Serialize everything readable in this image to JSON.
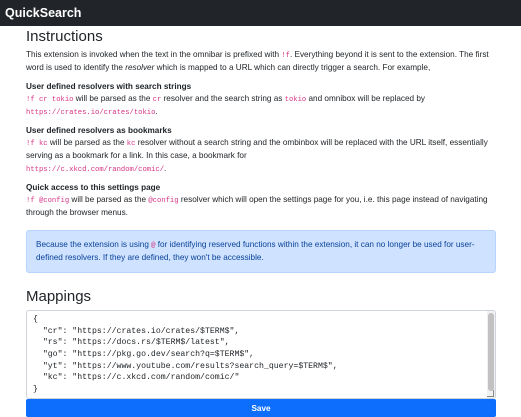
{
  "navbar": {
    "brand": "QuickSearch"
  },
  "instructions": {
    "title": "Instructions",
    "intro": {
      "t1": "This extension is invoked when the text in the omnibar is prefixed with ",
      "c1": "!f",
      "t2": ". Everything beyond it is sent to the extension. The first word is used to identify the ",
      "em": "resolver",
      "t3": " which is mapped to a URL which can directly trigger a search. For example,"
    },
    "search_strings": {
      "heading": "User defined resolvers with search strings",
      "c1": "!f cr tokio",
      "t1": " will be parsed as the ",
      "c2": "cr",
      "t2": " resolver and the search string as ",
      "c3": "tokio",
      "t3": " and omnibox will be replaced by ",
      "c4": "https://crates.io/crates/tokio",
      "t4": "."
    },
    "bookmarks": {
      "heading": "User defined resolvers as bookmarks",
      "c1": "!f kc",
      "t1": " will be parsed as the ",
      "c2": "kc",
      "t2": " resolver without a search string and the ombinbox will be replaced with the URL itself, essentially serving as a bookmark for a link. In this case, a bookmark for ",
      "c3": "https://c.xkcd.com/random/comic/",
      "t3": "."
    },
    "settings": {
      "heading": "Quick access to this settings page",
      "c1": "!f @config",
      "t1": " will be parsed as the ",
      "c2": "@config",
      "t2": " resolver which will open the settings page for you, i.e. this page instead of navigating through the browser menus."
    },
    "alert": {
      "t1": "Because the extension is using ",
      "c1": "@",
      "t2": " for identifying reserved functions within the extension, it can no longer be used for user-defined resolvers. If they are defined, they won't be accessible."
    }
  },
  "mappings": {
    "title": "Mappings",
    "json_text": "{\n  \"cr\": \"https://crates.io/crates/$TERM$\",\n  \"rs\": \"https://docs.rs/$TERM$/latest\",\n  \"go\": \"https://pkg.go.dev/search?q=$TERM$\",\n  \"yt\": \"https://www.youtube.com/results?search_query=$TERM$\",\n  \"kc\": \"https://c.xkcd.com/random/comic/\"\n}",
    "save_label": "Save"
  },
  "colors": {
    "navbar_bg": "#212529",
    "code": "#d63384",
    "alert_bg": "#cfe2ff",
    "alert_text": "#084298",
    "primary": "#0d6efd"
  }
}
